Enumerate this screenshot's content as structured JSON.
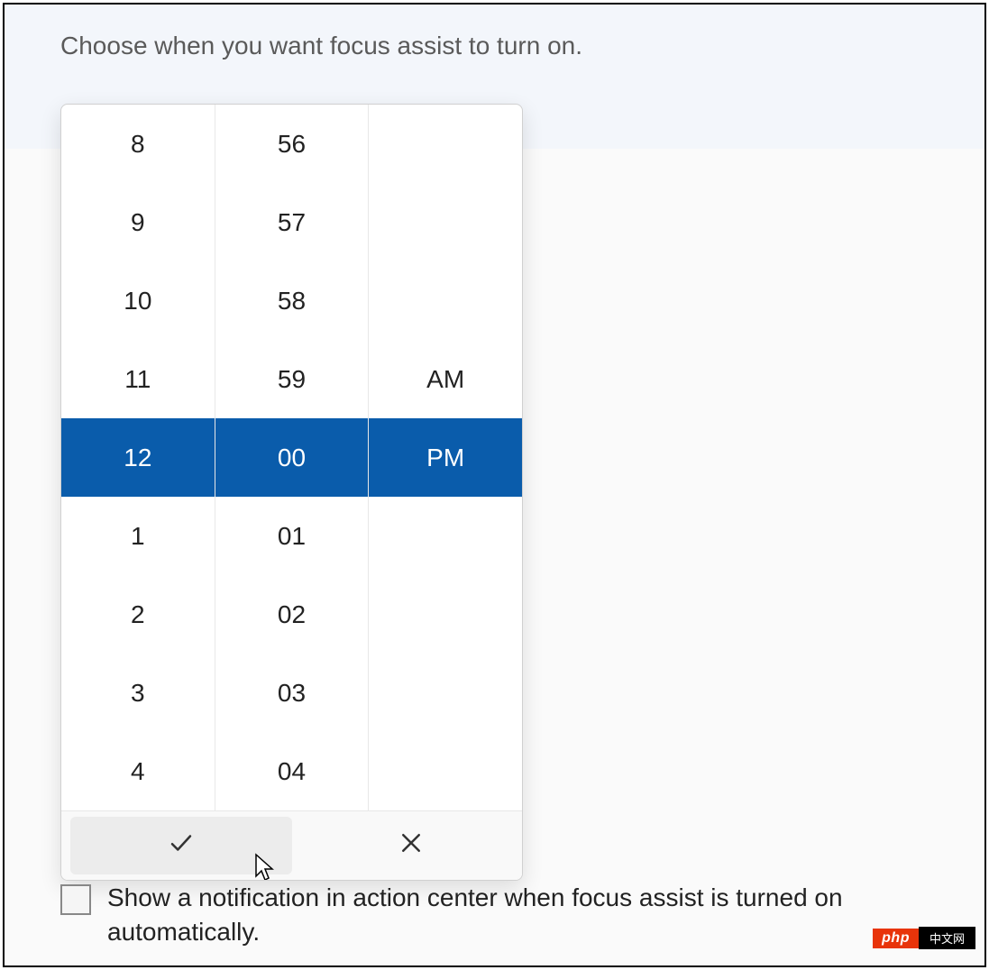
{
  "page": {
    "title": "Choose when you want focus assist to turn on."
  },
  "timePicker": {
    "hours": [
      "8",
      "9",
      "10",
      "11",
      "12",
      "1",
      "2",
      "3",
      "4"
    ],
    "minutes": [
      "56",
      "57",
      "58",
      "59",
      "00",
      "01",
      "02",
      "03",
      "04"
    ],
    "periods": [
      "",
      "",
      "",
      "AM",
      "PM",
      "",
      "",
      "",
      ""
    ],
    "selectedIndex": 4,
    "selectedHour": "12",
    "selectedMinute": "00",
    "selectedPeriod": "PM"
  },
  "checkbox": {
    "label": "Show a notification in action center when focus assist is turned on automatically.",
    "checked": false
  },
  "watermark": {
    "brand": "php",
    "text": "中文网"
  }
}
